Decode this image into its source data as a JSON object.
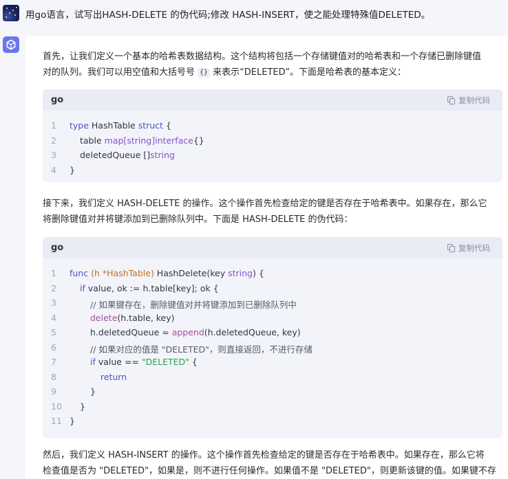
{
  "user_message": {
    "text": "用go语言，试写出HASH-DELETE 的伪代码;修改 HASH-INSERT，使之能处理特殊值DELETED。"
  },
  "answer": {
    "p1": {
      "line1": "首先，让我们定义一个基本的哈希表数据结构。这个结构将包括一个存储键值对的哈希表和一个存储已删除键值",
      "line2_a": "对的队列。我们可以用空值和大括号号",
      "line2_code": "{}",
      "line2_b": "来表示“DELETED”。下面是哈希表的基本定义："
    },
    "code1": {
      "lang": "go",
      "copy_label": "复制代码",
      "lines": [
        "1",
        "2",
        "3",
        "4"
      ],
      "l1_a": "type",
      "l1_b": " HashTable ",
      "l1_c": "struct",
      "l1_d": " {",
      "l2_a": "table ",
      "l2_b": "map",
      "l2_c": "[",
      "l2_d": "string",
      "l2_e": "]",
      "l2_f": "interface",
      "l2_g": "{}",
      "l3_a": "deletedQueue []",
      "l3_b": "string",
      "l4": "}"
    },
    "p2": {
      "line1": "接下来，我们定义 HASH-DELETE 的操作。这个操作首先检查给定的键是否存在于哈希表中。如果存在，那么它",
      "line2": "将删除键值对并将键添加到已删除队列中。下面是 HASH-DELETE 的伪代码："
    },
    "code2": {
      "lang": "go",
      "copy_label": "复制代码",
      "lines": [
        "1",
        "2",
        "3",
        "4",
        "5",
        "6",
        "7",
        "8",
        "9",
        "10",
        "11"
      ],
      "l1_a": "func",
      "l1_b": " (h *HashTable) ",
      "l1_c": "HashDelete",
      "l1_d": "(key ",
      "l1_e": "string",
      "l1_f": ") {",
      "l2_a": "if",
      "l2_b": " value, ok := h.table[key]; ok {",
      "l3": "// 如果键存在，删除键值对并将键添加到已删除队列中",
      "l4_a": "delete",
      "l4_b": "(h.table, key)",
      "l5_a": "h.deletedQueue = ",
      "l5_b": "append",
      "l5_c": "(h.deletedQueue, key)",
      "l6": "// 如果对应的值是 \"DELETED\"，则直接返回，不进行存储",
      "l7_a": "if",
      "l7_b": " value == ",
      "l7_c": "\"DELETED\"",
      "l7_d": " {",
      "l8": "return",
      "l9": "}",
      "l10": "}",
      "l11": "}"
    },
    "p3": {
      "line1": "然后，我们定义 HASH-INSERT 的操作。这个操作首先检查给定的键是否存在于哈希表中。如果存在，那么它将",
      "line2": "检查值是否为 \"DELETED\"，如果是，则不进行任何操作。如果值不是 \"DELETED\"，则更新该键的值。如果键不存"
    }
  }
}
